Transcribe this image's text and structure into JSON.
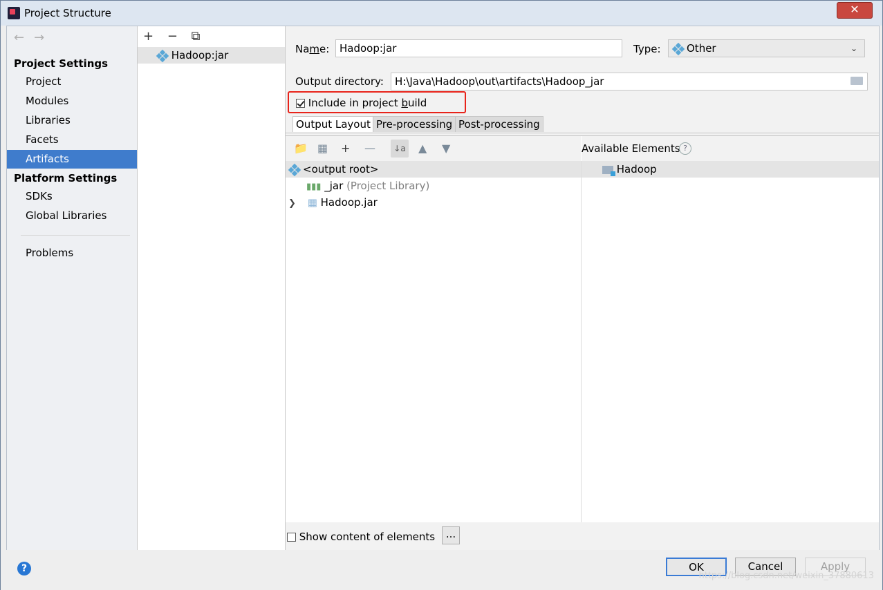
{
  "window": {
    "title": "Project Structure",
    "close_glyph": "✕"
  },
  "nav": {
    "back_glyph": "←",
    "forward_glyph": "→",
    "project_settings_heading": "Project Settings",
    "project_items": [
      "Project",
      "Modules",
      "Libraries",
      "Facets",
      "Artifacts"
    ],
    "selected_item": "Artifacts",
    "platform_settings_heading": "Platform Settings",
    "platform_items": [
      "SDKs",
      "Global Libraries"
    ],
    "problems_label": "Problems"
  },
  "artifacts": {
    "tools": [
      "+",
      "−",
      "⧉"
    ],
    "items": [
      "Hadoop:jar"
    ]
  },
  "form": {
    "name_label_pre": "Na",
    "name_label_ul": "m",
    "name_label_post": "e:",
    "name_value": "Hadoop:jar",
    "type_label": "Type:",
    "type_value": "Other",
    "output_dir_label": "Output directory:",
    "output_dir_value": "H:\\Java\\Hadoop\\out\\artifacts\\Hadoop_jar",
    "include_label_pre": "Include in project ",
    "include_label_ul": "b",
    "include_label_post": "uild",
    "include_checked": true
  },
  "tabs": [
    "Output Layout",
    "Pre-processing",
    "Post-processing"
  ],
  "selected_tab": "Output Layout",
  "layout": {
    "tree": [
      {
        "label": "<output root>",
        "note": ""
      },
      {
        "label": "_jar",
        "note": "(Project Library)"
      },
      {
        "label": "Hadoop.jar",
        "note": ""
      }
    ],
    "available_heading": "Available Elements",
    "available_items": [
      "Hadoop"
    ],
    "show_content_label": "Show content of elements",
    "dots_label": "..."
  },
  "footer": {
    "help_glyph": "?",
    "ok_label": "OK",
    "cancel_label": "Cancel",
    "apply_label": "Apply",
    "watermark": "https://blog.csdn.net/weixin_37880613"
  }
}
